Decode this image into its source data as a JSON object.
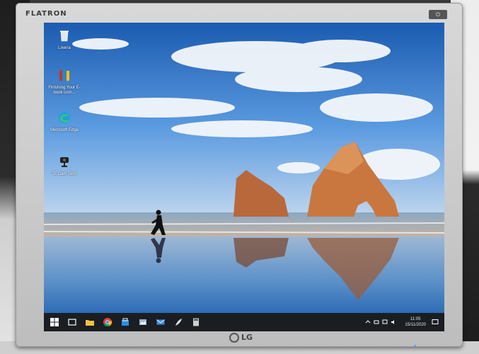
{
  "monitor": {
    "brand": "FLATRON",
    "maker_logo": "LG"
  },
  "desktop_icons": [
    {
      "label": "Lixeira",
      "icon": "recycle-bin-icon"
    },
    {
      "label": "Finishing Your E-book com...",
      "icon": "books-icon"
    },
    {
      "label": "Microsoft Edge",
      "icon": "edge-icon"
    },
    {
      "label": "TL Cam Tech",
      "icon": "webcam-icon"
    }
  ],
  "taskbar": {
    "pinned": [
      "windows-start-icon",
      "task-view-icon",
      "file-explorer-icon",
      "chrome-icon",
      "store-icon",
      "photos-icon",
      "mail-icon",
      "feather-icon",
      "calculator-icon"
    ],
    "clock_time": "11:05",
    "clock_date": "15/11/2020"
  },
  "colors": {
    "sky_top": "#1b5bb0",
    "sand": "#c7b09a",
    "taskbar": "#1a1d22"
  }
}
